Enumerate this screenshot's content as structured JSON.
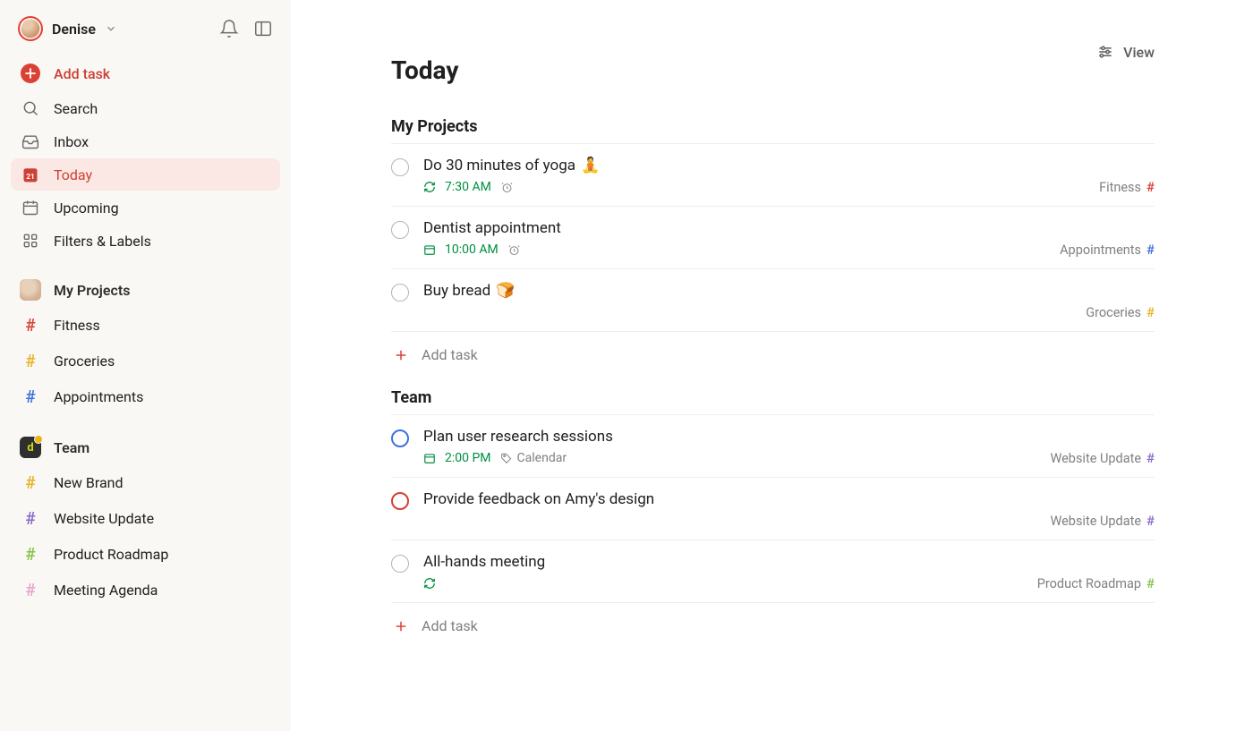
{
  "user": {
    "name": "Denise"
  },
  "sidebar": {
    "add_task_label": "Add task",
    "nav": [
      {
        "label": "Search",
        "icon": "search"
      },
      {
        "label": "Inbox",
        "icon": "inbox"
      },
      {
        "label": "Today",
        "icon": "calendar-today",
        "active": true
      },
      {
        "label": "Upcoming",
        "icon": "calendar-upcoming"
      },
      {
        "label": "Filters & Labels",
        "icon": "grid"
      }
    ],
    "my_projects": {
      "title": "My Projects",
      "items": [
        {
          "label": "Fitness",
          "color": "#db4035"
        },
        {
          "label": "Groceries",
          "color": "#e8b22a"
        },
        {
          "label": "Appointments",
          "color": "#3d72dd"
        }
      ]
    },
    "team": {
      "title": "Team",
      "items": [
        {
          "label": "New Brand",
          "color": "#e8b22a"
        },
        {
          "label": "Website Update",
          "color": "#8c6acb"
        },
        {
          "label": "Product Roadmap",
          "color": "#89c24a"
        },
        {
          "label": "Meeting Agenda",
          "color": "#e6a5cb"
        }
      ]
    }
  },
  "main": {
    "view_label": "View",
    "title": "Today",
    "add_task_label": "Add task",
    "sections": [
      {
        "title": "My Projects",
        "tasks": [
          {
            "title": "Do 30 minutes of yoga",
            "emoji": "🧘",
            "recurring": true,
            "time": "7:30 AM",
            "alarm": true,
            "project": "Fitness",
            "project_color": "#db4035",
            "priority": "none"
          },
          {
            "title": "Dentist appointment",
            "calendar": true,
            "time": "10:00 AM",
            "alarm": true,
            "project": "Appointments",
            "project_color": "#3d72dd",
            "priority": "none"
          },
          {
            "title": "Buy bread",
            "emoji": "🍞",
            "project": "Groceries",
            "project_color": "#e8b22a",
            "priority": "none"
          }
        ]
      },
      {
        "title": "Team",
        "tasks": [
          {
            "title": "Plan user research sessions",
            "calendar": true,
            "time": "2:00 PM",
            "label": "Calendar",
            "project": "Website Update",
            "project_color": "#8c6acb",
            "priority": "blue"
          },
          {
            "title": "Provide feedback on Amy's design",
            "project": "Website Update",
            "project_color": "#8c6acb",
            "priority": "red"
          },
          {
            "title": "All-hands meeting",
            "recurring": true,
            "project": "Product Roadmap",
            "project_color": "#89c24a",
            "priority": "none"
          }
        ]
      }
    ]
  },
  "colors": {
    "accent": "#db4035",
    "green": "#018f3f"
  }
}
